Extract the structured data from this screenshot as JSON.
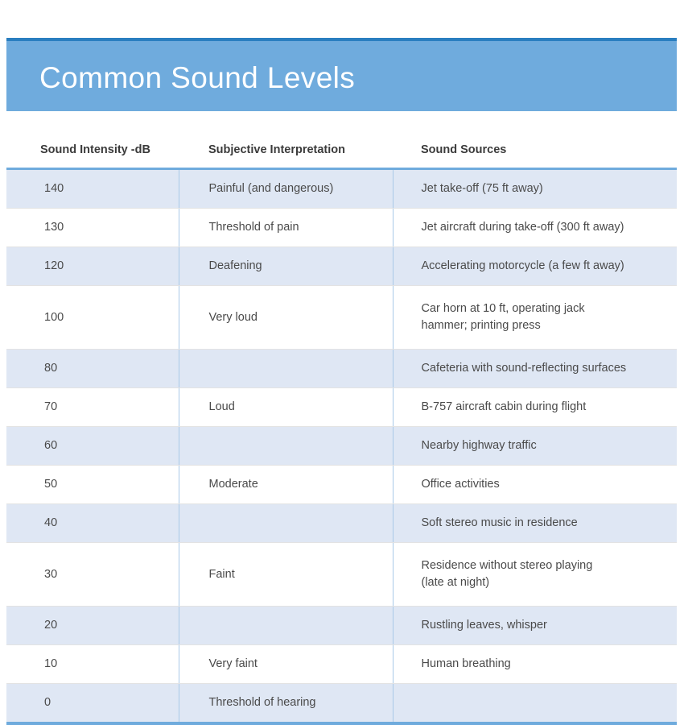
{
  "banner": {
    "title": "Common Sound Levels",
    "background_color": "#6fabdd",
    "top_rule_color": "#2a7ec0",
    "title_color": "#ffffff"
  },
  "table": {
    "accent_color": "#6fabdd",
    "shaded_row_color": "#dfe7f4",
    "divider_color": "#a9c9e8",
    "text_color": "#4a4a4a",
    "columns": [
      "Sound Intensity -dB",
      "Subjective Interpretation",
      "Sound Sources"
    ],
    "rows": [
      {
        "db": "140",
        "interpretation": "Painful (and dangerous)",
        "source": "Jet take-off (75 ft away)",
        "shaded": true
      },
      {
        "db": "130",
        "interpretation": "Threshold of pain",
        "source": "Jet aircraft during take-off (300 ft away)",
        "shaded": false
      },
      {
        "db": "120",
        "interpretation": "Deafening",
        "source": "Accelerating motorcycle (a few ft away)",
        "shaded": true
      },
      {
        "db": "100",
        "interpretation": "Very loud",
        "source": "Car horn at 10 ft, operating jack\nhammer; printing press",
        "shaded": false
      },
      {
        "db": "80",
        "interpretation": "",
        "source": "Cafeteria with sound-reflecting surfaces",
        "shaded": true
      },
      {
        "db": "70",
        "interpretation": "Loud",
        "source": "B-757 aircraft cabin during flight",
        "shaded": false
      },
      {
        "db": "60",
        "interpretation": "",
        "source": "Nearby highway traffic",
        "shaded": true
      },
      {
        "db": "50",
        "interpretation": "Moderate",
        "source": "Office activities",
        "shaded": false
      },
      {
        "db": "40",
        "interpretation": "",
        "source": "Soft stereo music in residence",
        "shaded": true
      },
      {
        "db": "30",
        "interpretation": "Faint",
        "source": "Residence without stereo playing\n(late at night)",
        "shaded": false
      },
      {
        "db": "20",
        "interpretation": "",
        "source": "Rustling leaves, whisper",
        "shaded": true
      },
      {
        "db": "10",
        "interpretation": "Very faint",
        "source": "Human breathing",
        "shaded": false
      },
      {
        "db": "0",
        "interpretation": "Threshold of hearing",
        "source": "",
        "shaded": true
      }
    ]
  }
}
